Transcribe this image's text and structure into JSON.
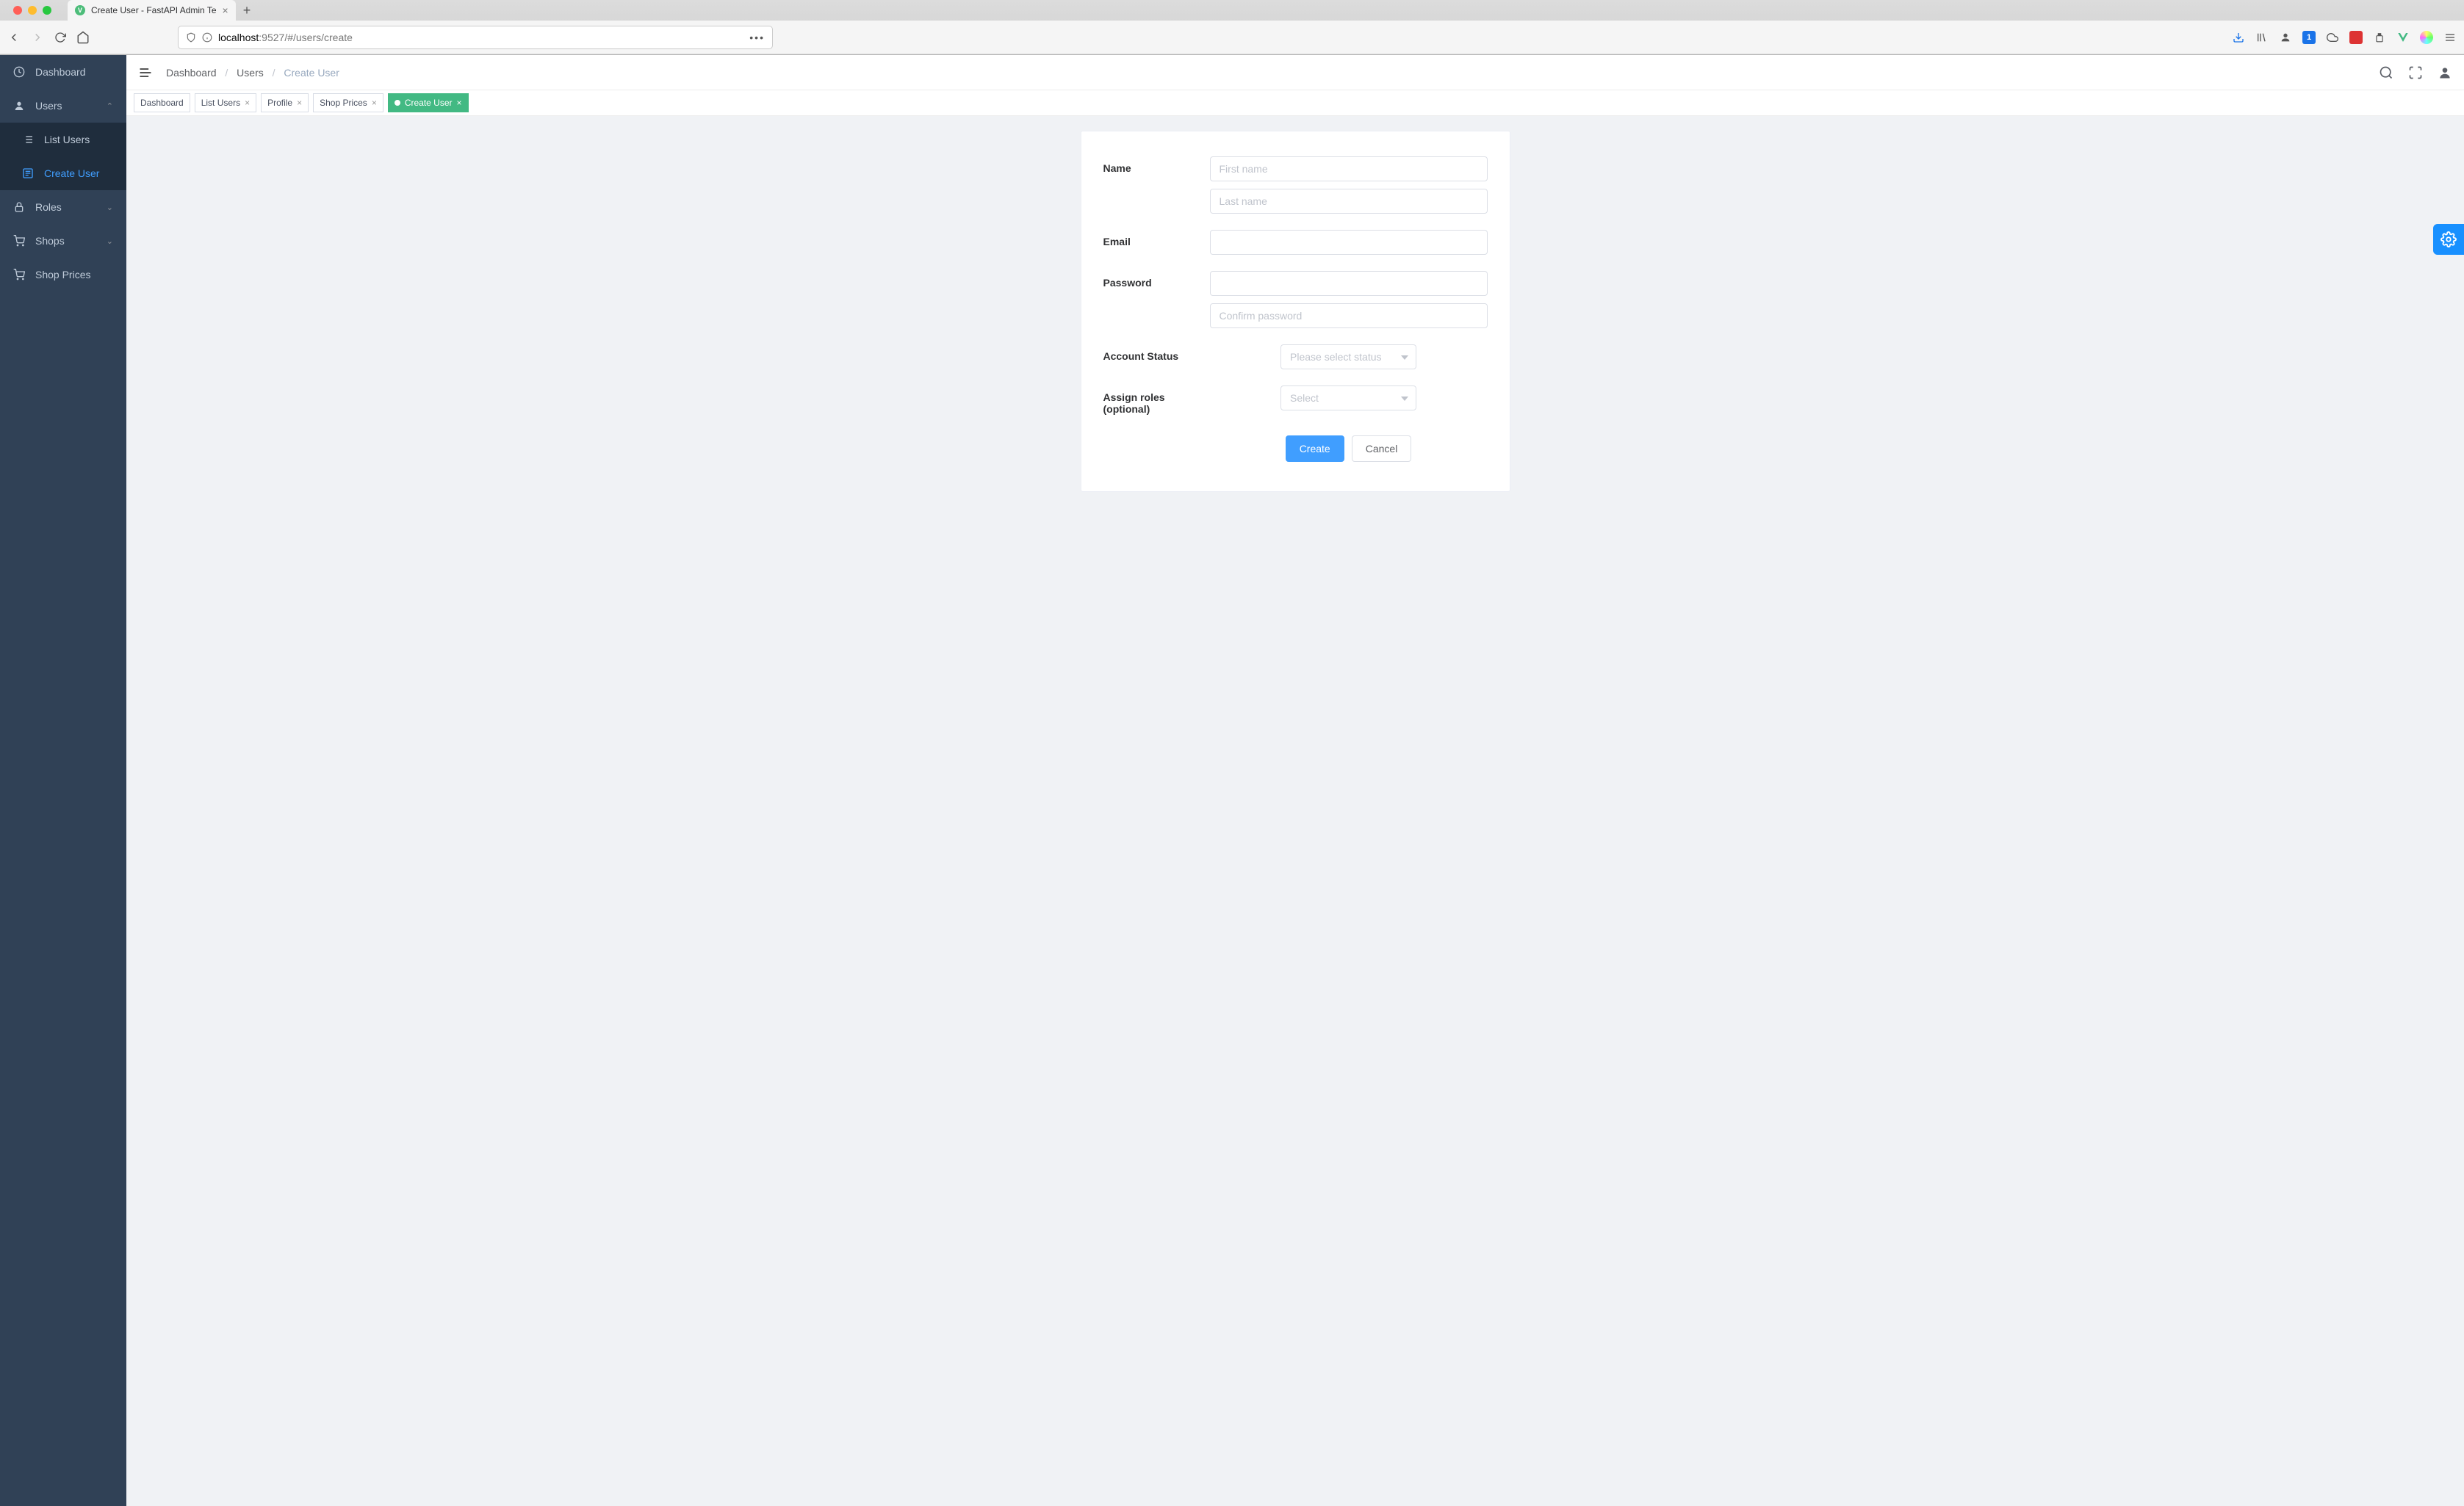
{
  "browser": {
    "tab_title": "Create User - FastAPI Admin Te",
    "url_host": "localhost",
    "url_port": ":9527",
    "url_path": "/#/users/create"
  },
  "sidebar": {
    "items": [
      {
        "label": "Dashboard",
        "icon": "dashboard"
      },
      {
        "label": "Users",
        "icon": "user",
        "expanded": true
      },
      {
        "label": "List Users",
        "sub": true
      },
      {
        "label": "Create User",
        "sub": true,
        "active": true
      },
      {
        "label": "Roles",
        "icon": "lock",
        "chev": true
      },
      {
        "label": "Shops",
        "icon": "cart",
        "chev": true
      },
      {
        "label": "Shop Prices",
        "icon": "cart"
      }
    ]
  },
  "breadcrumb": {
    "items": [
      "Dashboard",
      "Users",
      "Create User"
    ]
  },
  "tags": [
    {
      "label": "Dashboard",
      "closable": false
    },
    {
      "label": "List Users",
      "closable": true
    },
    {
      "label": "Profile",
      "closable": true
    },
    {
      "label": "Shop Prices",
      "closable": true
    },
    {
      "label": "Create User",
      "closable": true,
      "active": true
    }
  ],
  "form": {
    "name_label": "Name",
    "first_name_placeholder": "First name",
    "last_name_placeholder": "Last name",
    "email_label": "Email",
    "password_label": "Password",
    "confirm_password_placeholder": "Confirm password",
    "status_label": "Account Status",
    "status_placeholder": "Please select status",
    "roles_label": "Assign roles (optional)",
    "roles_placeholder": "Select",
    "create_btn": "Create",
    "cancel_btn": "Cancel"
  }
}
